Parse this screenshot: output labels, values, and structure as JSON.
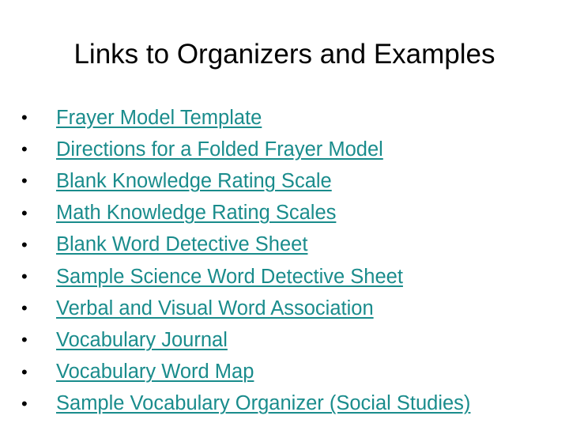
{
  "title": "Links to Organizers and Examples",
  "link_color": "#1a8c8c",
  "bullet_glyph": "•",
  "links": [
    {
      "label": "Frayer Model Template"
    },
    {
      "label": "Directions for a Folded Frayer Model"
    },
    {
      "label": "Blank Knowledge Rating Scale"
    },
    {
      "label": "Math Knowledge Rating Scales"
    },
    {
      "label": "Blank Word Detective Sheet"
    },
    {
      "label": "Sample Science Word Detective Sheet"
    },
    {
      "label": "Verbal and Visual Word Association"
    },
    {
      "label": "Vocabulary Journal"
    },
    {
      "label": "Vocabulary Word Map"
    },
    {
      "label": "Sample Vocabulary Organizer (Social Studies)"
    }
  ]
}
